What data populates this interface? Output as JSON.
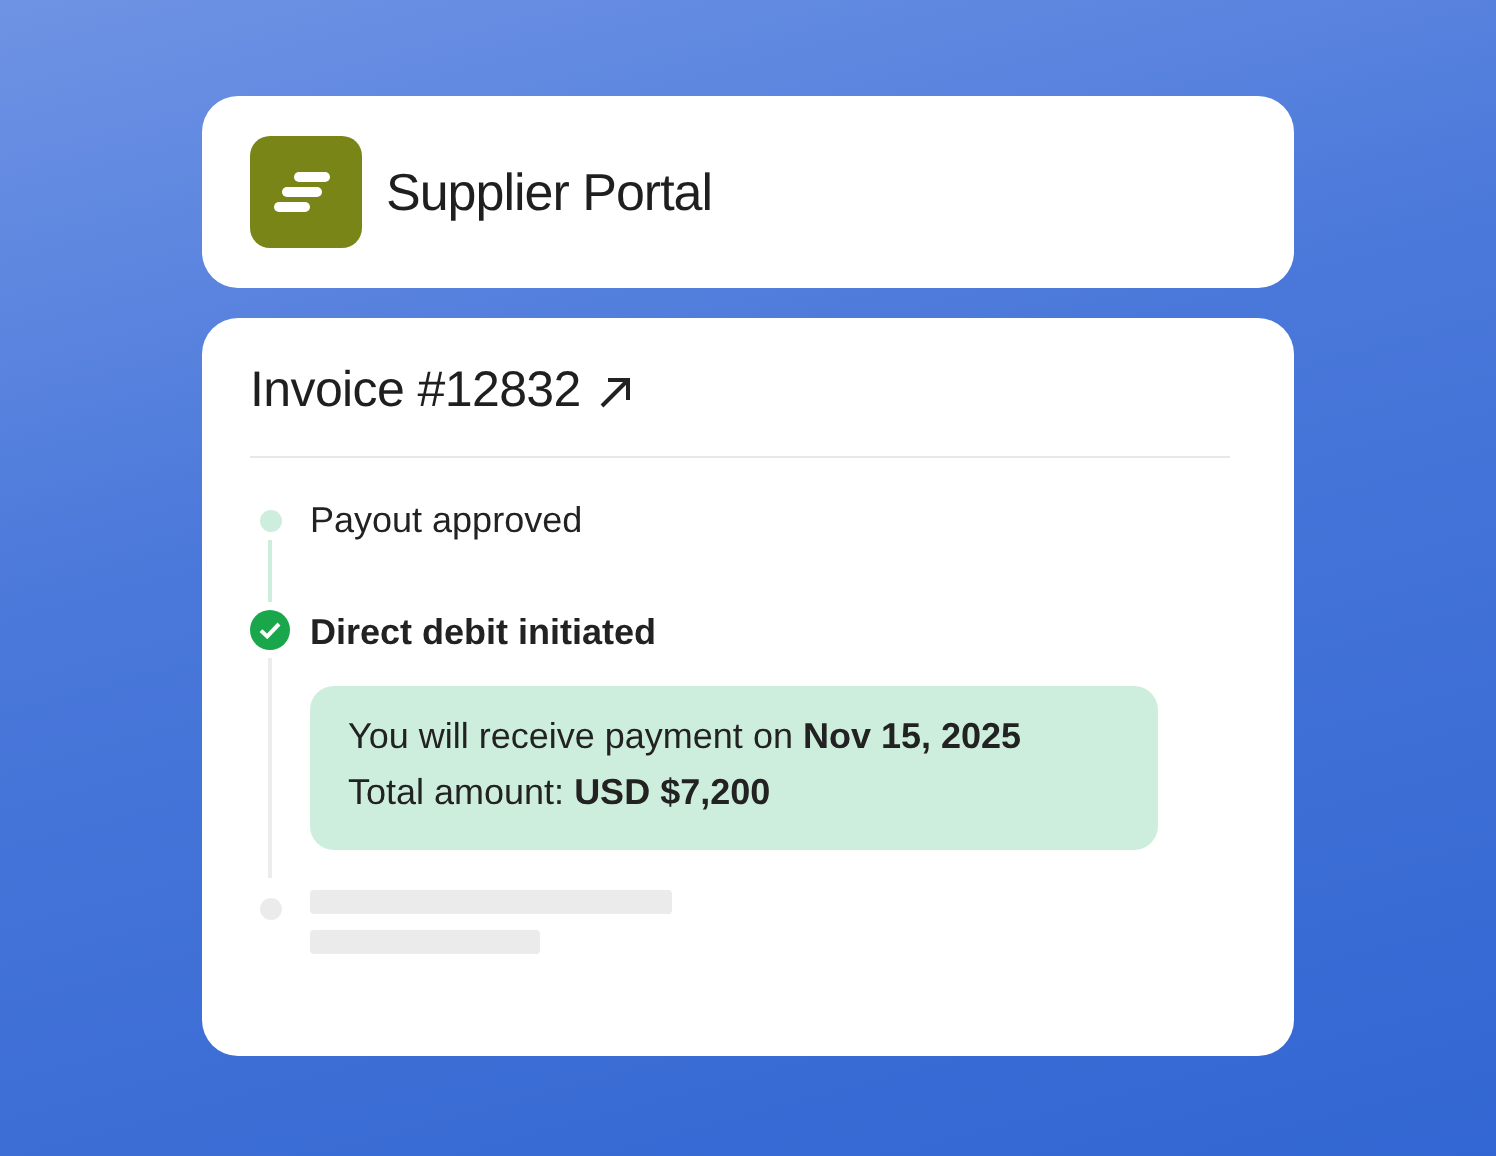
{
  "header": {
    "title": "Supplier Portal"
  },
  "invoice": {
    "title": "Invoice #12832",
    "steps": [
      {
        "kind": "done",
        "label": "Payout approved"
      },
      {
        "kind": "current",
        "label": "Direct debit initiated",
        "details": [
          "You will receive payment on **Nov 15, 2025**",
          "Total amount: **USD $7,200**"
        ]
      },
      {
        "kind": "pending"
      }
    ]
  }
}
